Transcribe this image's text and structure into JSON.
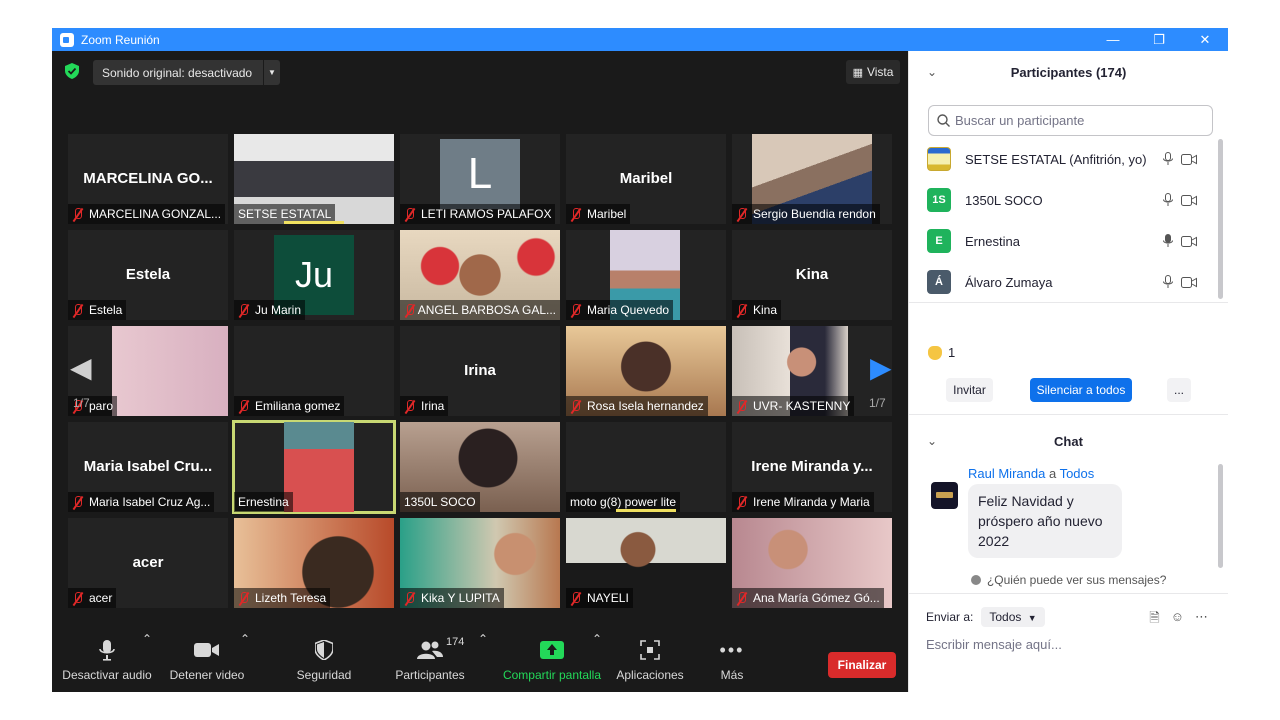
{
  "window": {
    "title": "Zoom Reunión"
  },
  "top": {
    "sound": "Sonido original: desactivado",
    "view": "Vista"
  },
  "tiles": [
    {
      "label": "MARCELINA GONZAL...",
      "big": "MARCELINA GO..."
    },
    {
      "label": "SETSE ESTATAL"
    },
    {
      "label": "LETI RAMOS PALAFOX",
      "initial": "L"
    },
    {
      "label": "Maribel",
      "big": "Maribel"
    },
    {
      "label": "Sergio Buendia rendon"
    },
    {
      "label": "Estela",
      "big": "Estela"
    },
    {
      "label": "Ju Marin",
      "initial": "Ju"
    },
    {
      "label": "ANGEL BARBOSA GAL..."
    },
    {
      "label": "Maria Quevedo"
    },
    {
      "label": "Kina",
      "big": "Kina"
    },
    {
      "label": "paro"
    },
    {
      "label": "Emiliana gomez"
    },
    {
      "label": "Irina",
      "big": "Irina"
    },
    {
      "label": "Rosa Isela hernandez"
    },
    {
      "label": "UVR- KASTENNY"
    },
    {
      "label": "Maria Isabel Cruz Ag...",
      "big": "Maria Isabel Cru..."
    },
    {
      "label": "Ernestina"
    },
    {
      "label": "1350L SOCO"
    },
    {
      "label": "moto g(8) power lite"
    },
    {
      "label": "Irene Miranda y Maria",
      "big": "Irene Miranda y..."
    },
    {
      "label": "acer",
      "big": "acer"
    },
    {
      "label": "Lizeth Teresa"
    },
    {
      "label": "Kika Y LUPITA"
    },
    {
      "label": "NAYELI"
    },
    {
      "label": "Ana María Gómez Gó..."
    }
  ],
  "pager": {
    "left": "1/7",
    "right": "1/7"
  },
  "toolbar": {
    "mute": "Desactivar audio",
    "video": "Detener video",
    "security": "Seguridad",
    "participants": "Participantes",
    "participants_count": "174",
    "share": "Compartir pantalla",
    "apps": "Aplicaciones",
    "more": "Más",
    "end": "Finalizar"
  },
  "participants_panel": {
    "title": "Participantes (174)",
    "search_placeholder": "Buscar un participante",
    "list": [
      {
        "name": "SETSE ESTATAL (Anfitrión, yo)",
        "avatar": ""
      },
      {
        "name": "1350L SOCO",
        "avatar": "1S",
        "color": "#1fb35c"
      },
      {
        "name": "Ernestina",
        "avatar": "E",
        "color": "#1fb35c"
      },
      {
        "name": "Álvaro Zumaya",
        "avatar": "Á",
        "color": "#4a5a6a"
      }
    ],
    "reaction_count": "1",
    "invite": "Invitar",
    "mute_all": "Silenciar a todos",
    "more": "..."
  },
  "chat": {
    "title": "Chat",
    "sender": "Raul Miranda",
    "to_word": "a",
    "recipient": "Todos",
    "message": "Feliz Navidad y próspero año nuevo 2022",
    "who_can_see": "¿Quién puede ver sus mensajes?",
    "send_to_label": "Enviar a:",
    "send_to_value": "Todos",
    "input_placeholder": "Escribir mensaje aquí..."
  }
}
